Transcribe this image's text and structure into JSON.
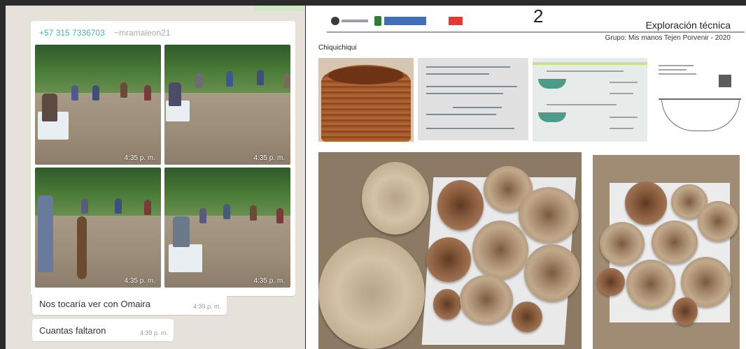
{
  "chat": {
    "sender": {
      "phone": "+57 315 7336703",
      "nickname": "~mramaleon21"
    },
    "media_timestamps": [
      "4:35 p. m.",
      "4:35 p. m.",
      "4:35 p. m.",
      "4:35 p. m."
    ],
    "messages": [
      {
        "text": "Nos tocaría ver con Omaira",
        "time": "4:39 p. m."
      },
      {
        "text": "Cuantas faltaron",
        "time": "4:39 p. m."
      }
    ]
  },
  "document": {
    "page_number": "2",
    "title": "Exploración técnica",
    "group": "Grupo: Mis manos Tejen Porvenir - 2020",
    "section_label": "Chiquichiqui"
  },
  "colors": {
    "chat_background": "#e6e1d9",
    "sender_phone": "#4fb3a8",
    "logo_red": "#e53935",
    "logo_blue": "#3f6fb8"
  }
}
